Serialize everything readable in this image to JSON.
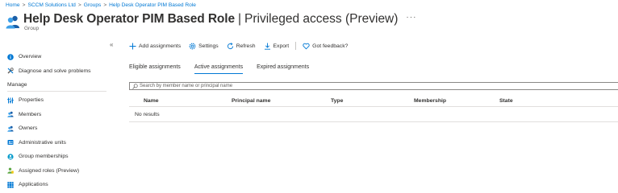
{
  "breadcrumb": [
    "Home",
    "SCCM Solutions Ltd",
    "Groups",
    "Help Desk Operator PIM Based Role"
  ],
  "header": {
    "title": "Help Desk Operator PIM Based Role",
    "separator": "|",
    "subtitle": "Privileged access (Preview)",
    "more": "···",
    "type": "Group"
  },
  "collapse_glyph": "«",
  "sidebar": {
    "top_items": [
      {
        "label": "Overview",
        "icon": "info-icon"
      },
      {
        "label": "Diagnose and solve problems",
        "icon": "wrench-icon"
      }
    ],
    "section": "Manage",
    "manage_items": [
      {
        "label": "Properties",
        "icon": "properties-icon"
      },
      {
        "label": "Members",
        "icon": "members-icon"
      },
      {
        "label": "Owners",
        "icon": "owners-icon"
      },
      {
        "label": "Administrative units",
        "icon": "admin-units-icon"
      },
      {
        "label": "Group memberships",
        "icon": "group-memberships-icon"
      },
      {
        "label": "Assigned roles (Preview)",
        "icon": "assigned-roles-icon"
      },
      {
        "label": "Applications",
        "icon": "applications-icon"
      }
    ]
  },
  "toolbar": {
    "add": "Add assignments",
    "settings": "Settings",
    "refresh": "Refresh",
    "export": "Export",
    "feedback": "Got feedback?"
  },
  "tabs": [
    {
      "label": "Eligible assignments",
      "active": false
    },
    {
      "label": "Active assignments",
      "active": true
    },
    {
      "label": "Expired assignments",
      "active": false
    }
  ],
  "search": {
    "placeholder": "Search by member name or principal name"
  },
  "table": {
    "columns": [
      "Name",
      "Principal name",
      "Type",
      "Membership",
      "State"
    ],
    "empty_text": "No results"
  },
  "colors": {
    "accent": "#0078d4",
    "text": "#323130",
    "muted": "#605e5c",
    "border": "#e1dfdd"
  }
}
